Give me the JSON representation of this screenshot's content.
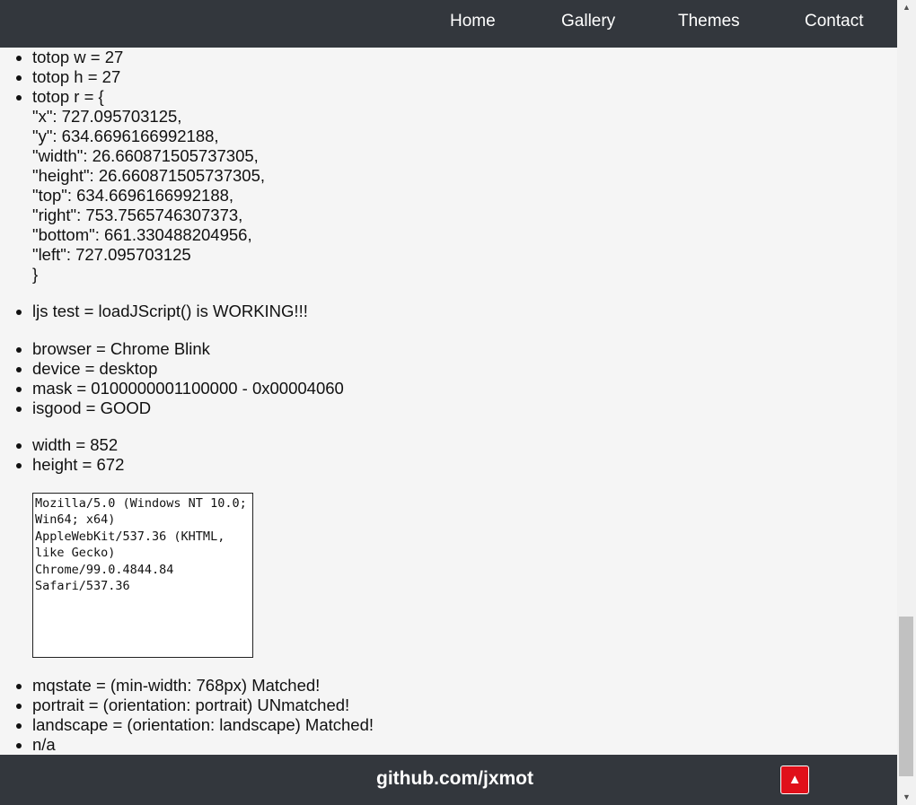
{
  "nav": {
    "items": [
      {
        "label": "Home"
      },
      {
        "label": "Gallery"
      },
      {
        "label": "Themes"
      },
      {
        "label": "Contact"
      }
    ]
  },
  "info": {
    "totop": {
      "w": "totop w = 27",
      "h": "totop h = 27",
      "r": "totop r = {\n\"x\": 727.095703125,\n\"y\": 634.6696166992188,\n\"width\": 26.660871505737305,\n\"height\": 26.660871505737305,\n\"top\": 634.6696166992188,\n\"right\": 753.7565746307373,\n\"bottom\": 661.330488204956,\n\"left\": 727.095703125\n}"
    },
    "ljs": "ljs test = loadJScript() is WORKING!!!",
    "browser": "browser = Chrome Blink",
    "device": "device = desktop",
    "mask": "mask = 0100000001100000 - 0x00004060",
    "isgood": "isgood = GOOD",
    "width": "width = 852",
    "height": "height = 672",
    "useragent": "Mozilla/5.0 (Windows NT 10.0; Win64; x64) AppleWebKit/537.36 (KHTML, like Gecko) Chrome/99.0.4844.84 Safari/537.36",
    "mqstate": "mqstate = (min-width: 768px) Matched!",
    "portrait": "portrait = (orientation: portrait) UNmatched!",
    "landscape": "landscape = (orientation: landscape) Matched!",
    "na": "n/a"
  },
  "footer": {
    "link": "github.com/jxmot",
    "totop_glyph": "▲"
  },
  "colors": {
    "bar_bg": "#33373d",
    "page_bg": "#f5f5f5",
    "totop_bg": "#e0101a"
  }
}
